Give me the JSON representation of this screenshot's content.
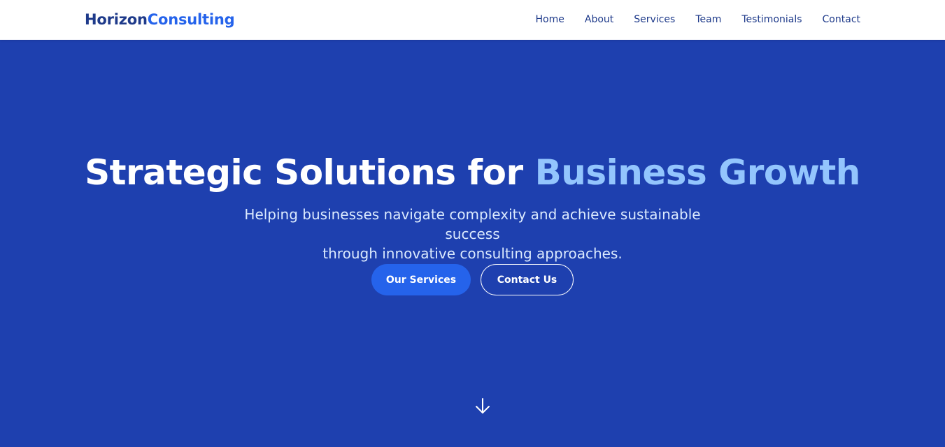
{
  "navbar": {
    "logo": {
      "part1": "Horizon",
      "part2": "Consulting"
    },
    "links": [
      "Home",
      "About",
      "Services",
      "Team",
      "Testimonials",
      "Contact"
    ]
  },
  "hero": {
    "title_main": "Strategic Solutions for",
    "title_accent": "Business Growth",
    "subtitle_line1": "Helping businesses navigate complexity and achieve sustainable success",
    "subtitle_line2": "through innovative consulting approaches.",
    "primary_button": "Our Services",
    "secondary_button": "Contact Us",
    "scroll_icon": "arrow-down-icon"
  },
  "colors": {
    "brand_dark": "#1e3a8a",
    "brand_accent": "#2563eb",
    "hero_background": "#1e40af",
    "title_accent": "#93c5fd"
  }
}
